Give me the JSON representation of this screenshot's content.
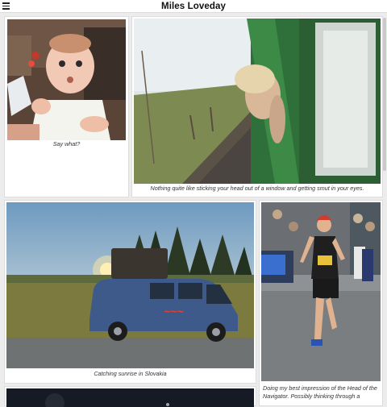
{
  "header": {
    "title": "Miles Loveday",
    "menu_icon": "hamburger-menu-icon"
  },
  "gallery": [
    {
      "caption": "Say what?"
    },
    {
      "caption": "Nothing quite like sticking your head out of a window and getting smut in your eyes."
    },
    {
      "caption": "Catching sunrise in Slovakia"
    },
    {
      "caption": "Doing my best impression of the Head of the Navigator. Possibly thinking through a"
    }
  ],
  "colors": {
    "background": "#ececec",
    "card": "#ffffff",
    "title": "#111111"
  }
}
